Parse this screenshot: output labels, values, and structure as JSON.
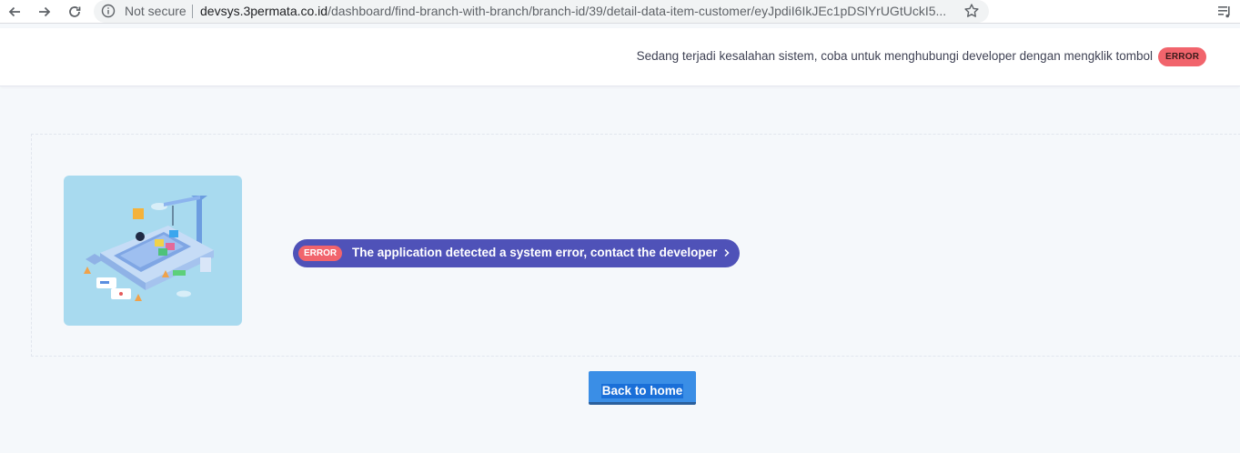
{
  "browser": {
    "security_label": "Not secure",
    "url_host": "devsys.3permata.co.id",
    "url_path": "/dashboard/find-branch-with-branch/branch-id/39/detail-data-item-customer/eyJpdiI6IkJEc1pDSlYrUGtUckI5..."
  },
  "header": {
    "message": "Sedang terjadi kesalahan sistem, coba untuk menghubungi developer dengan mengklik tombol",
    "badge": "ERROR"
  },
  "error_banner": {
    "badge": "ERROR",
    "message": "The application detected a system error, contact the developer"
  },
  "actions": {
    "back_home": "Back to home"
  },
  "colors": {
    "accent_blue": "#3a8ee6",
    "pill_indigo": "#4f52b8",
    "error_red": "#f1646c"
  }
}
